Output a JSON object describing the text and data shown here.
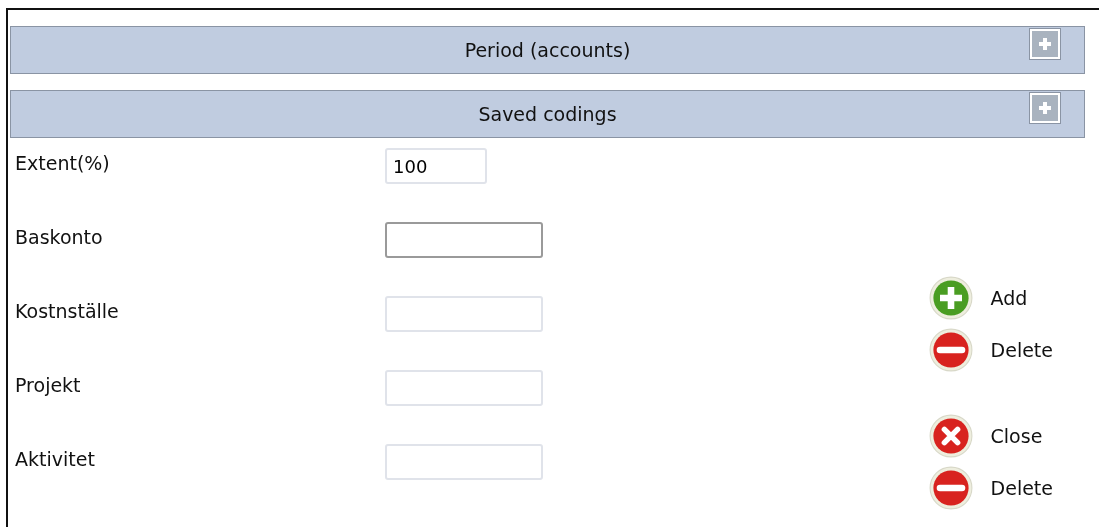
{
  "sections": [
    {
      "title": "Period (accounts)",
      "expanded": false
    },
    {
      "title": "Saved codings",
      "expanded": false
    }
  ],
  "fields": [
    {
      "label": "Extent(%)",
      "value": "100",
      "kind": "short",
      "focused": false
    },
    {
      "label": "Baskonto",
      "kind": "long",
      "focused": true
    },
    {
      "label": "Kostnställe",
      "kind": "long",
      "focused": false
    },
    {
      "label": "Projekt",
      "kind": "long",
      "focused": false
    },
    {
      "label": "Aktivitet",
      "kind": "long",
      "focused": false
    }
  ],
  "action_groups": [
    [
      {
        "label": "Add",
        "kind": "add"
      },
      {
        "label": "Delete",
        "kind": "delete"
      }
    ],
    [
      {
        "label": "Close",
        "kind": "close"
      },
      {
        "label": "Delete",
        "kind": "delete"
      }
    ]
  ]
}
